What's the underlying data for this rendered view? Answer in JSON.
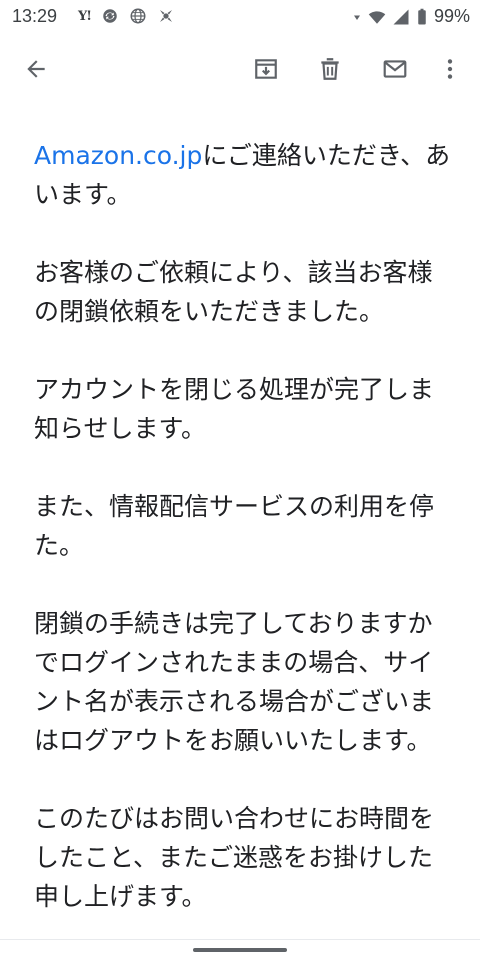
{
  "status_bar": {
    "time": "13:29",
    "left_icons": [
      "yahoo-icon",
      "sync-icon",
      "globe-icon",
      "app-icon"
    ],
    "right_icons": [
      "dnd-icon",
      "wifi-icon",
      "signal-icon",
      "battery-icon"
    ],
    "battery": "99%",
    "yahoo_label": "Y!"
  },
  "app_bar": {
    "icons": [
      "back-arrow-icon",
      "archive-icon",
      "delete-icon",
      "mark-unread-icon",
      "more-vert-icon"
    ]
  },
  "email": {
    "p1_link": "Amazon.co.jp",
    "p1_rest": "にご連絡いただき、あ",
    "p1_l2": "います。",
    "p2_l1": "お客様のご依頼により、該当お客様",
    "p2_l2": "の閉鎖依頼をいただきました。",
    "p3_l1": "アカウントを閉じる処理が完了しま",
    "p3_l2": "知らせします。",
    "p4_l1": "また、情報配信サービスの利用を停",
    "p4_l2": "た。",
    "p5_l1": "閉鎖の手続きは完了しておりますか",
    "p5_l2": "でログインされたままの場合、サイ",
    "p5_l3": "ント名が表示される場合がございま",
    "p5_l4": "はログアウトをお願いいたします。",
    "p6_l1": "このたびはお問い合わせにお時間を",
    "p6_l2": "したこと、またご迷惑をお掛けした",
    "p6_l3": "申し上げます。"
  },
  "colors": {
    "link": "#1a73e8",
    "text": "#202124",
    "icon": "#5f6368"
  }
}
